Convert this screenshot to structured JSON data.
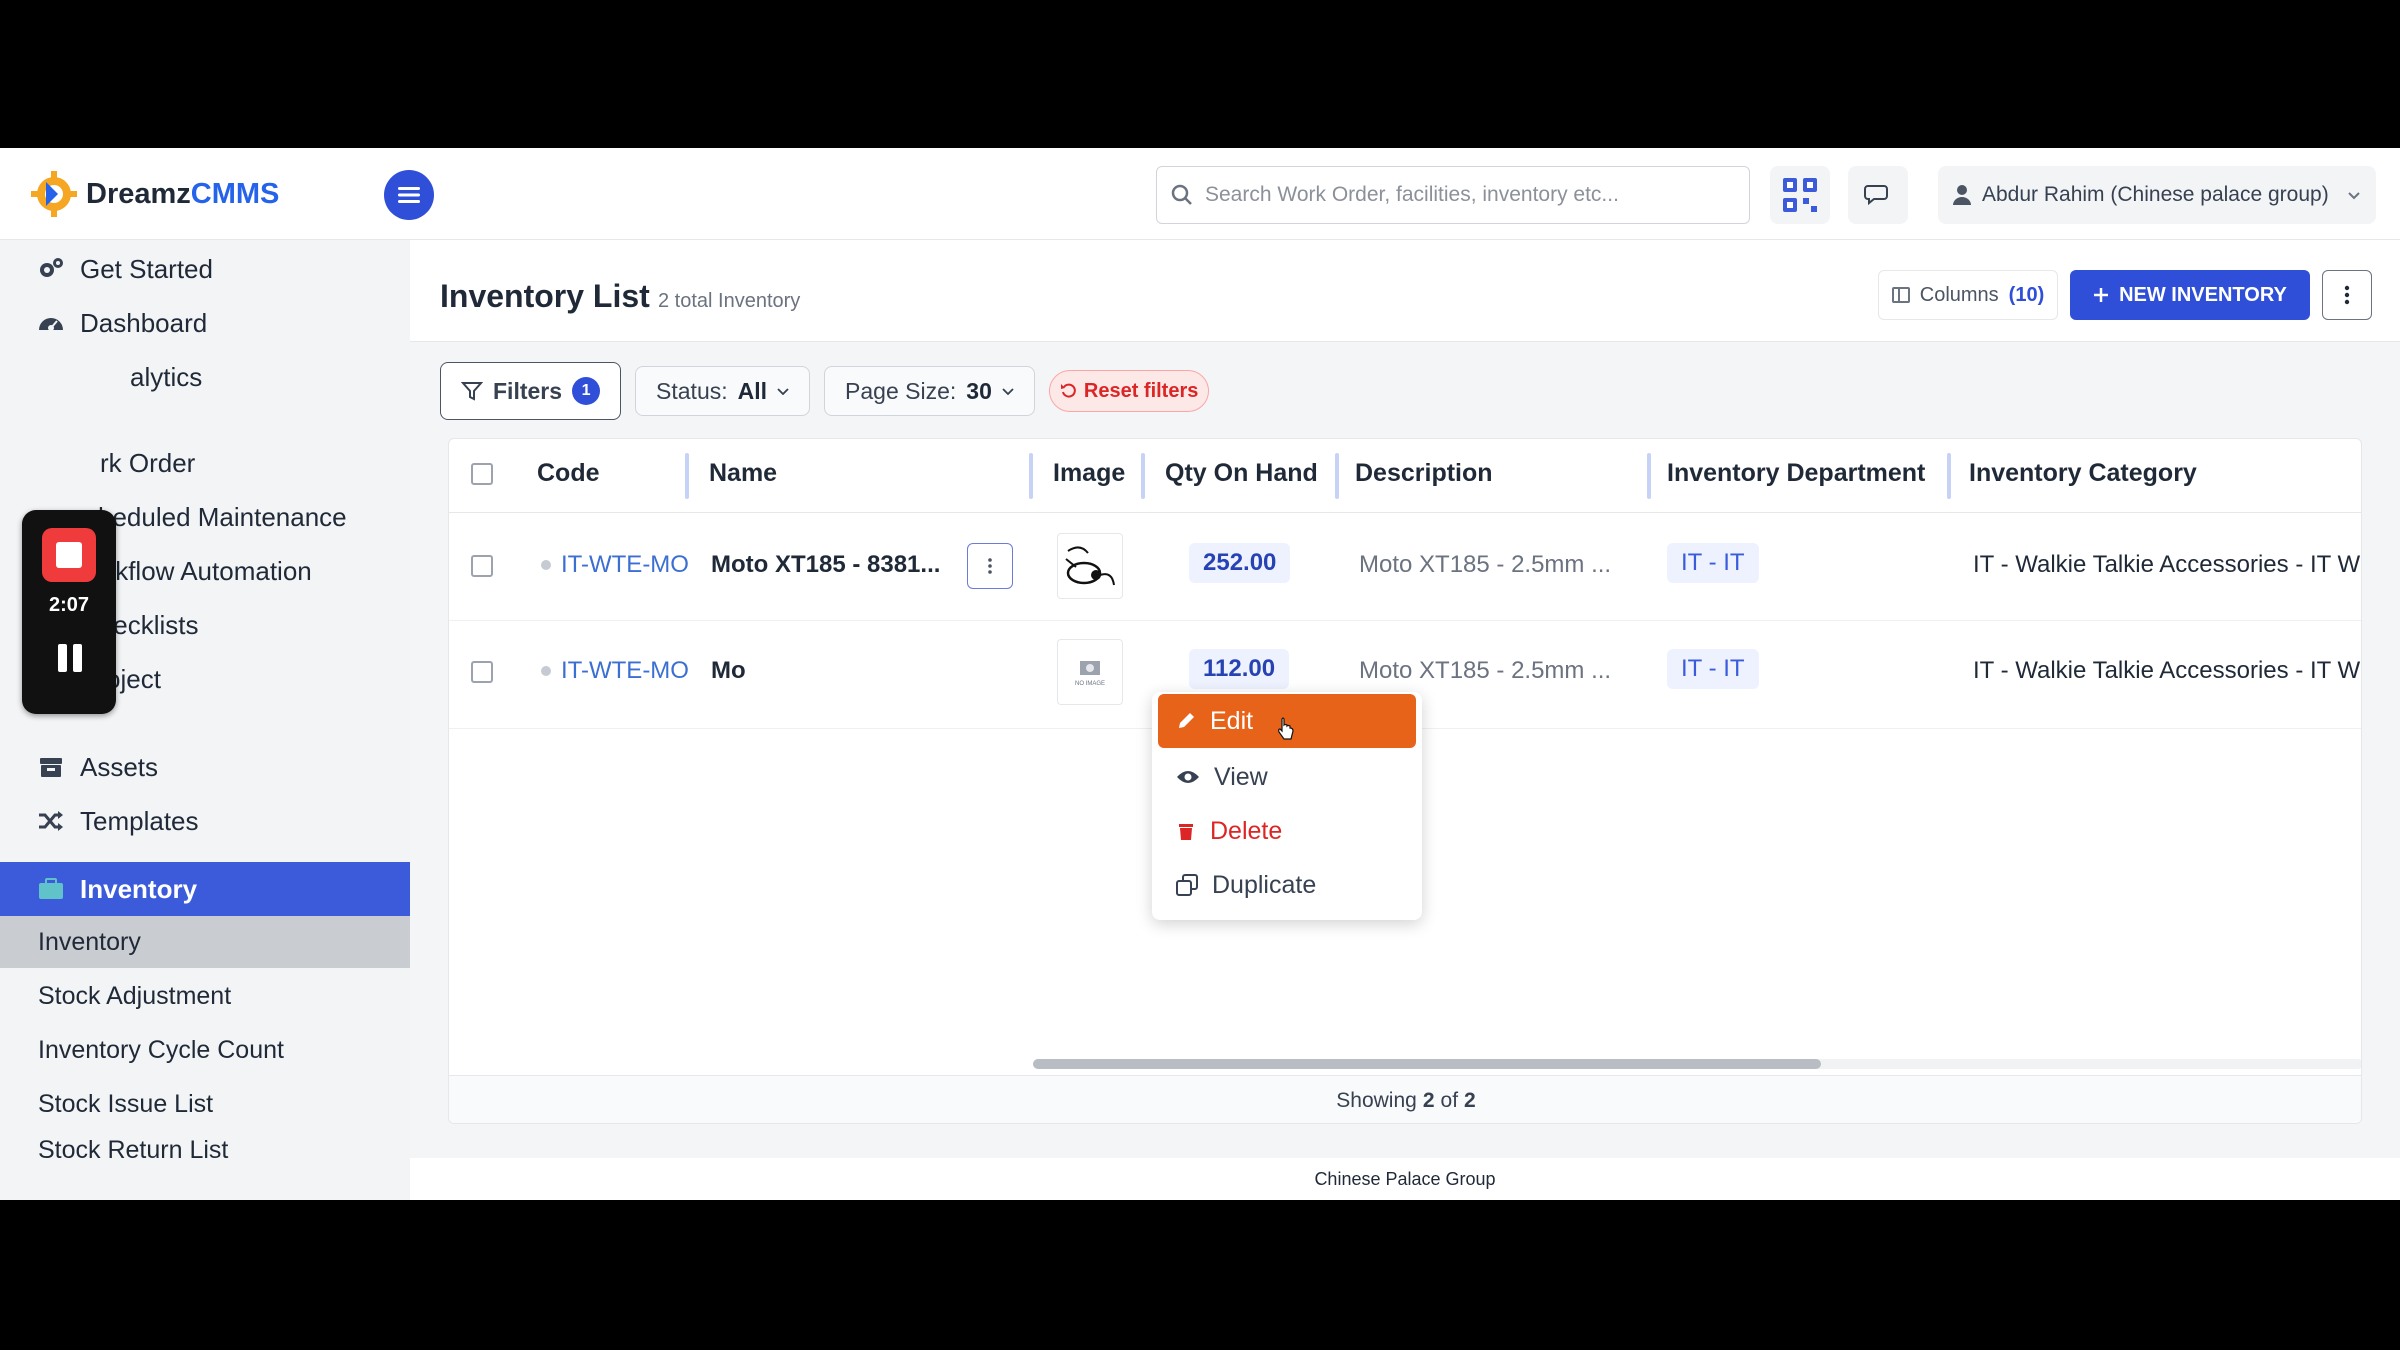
{
  "app": {
    "brand_prefix": "Dreamz",
    "brand_suffix": "CMMS",
    "search_placeholder": "Search Work Order, facilities, inventory etc...",
    "user_name": "Abdur Rahim (Chinese palace group)"
  },
  "sidebar": {
    "items": [
      {
        "label": "Get Started",
        "icon": "gears-icon"
      },
      {
        "label": "Dashboard",
        "icon": "dashboard-icon"
      },
      {
        "label": "alytics",
        "icon": "analytics-icon"
      },
      {
        "label": "rk Order",
        "icon": "work-order-icon"
      },
      {
        "label": "heduled Maintenance",
        "icon": "schedule-icon"
      },
      {
        "label": "Workflow Automation",
        "icon": "workflow-icon"
      },
      {
        "label": "Checklists",
        "icon": "checkbox-icon"
      },
      {
        "label": "Project",
        "icon": "project-icon"
      },
      {
        "label": "Assets",
        "icon": "assets-icon"
      },
      {
        "label": "Templates",
        "icon": "shuffle-icon"
      },
      {
        "label": "Inventory",
        "icon": "briefcase-icon"
      }
    ],
    "sub_items": [
      "Inventory",
      "Stock Adjustment",
      "Inventory Cycle Count",
      "Stock Issue List",
      "Stock Return List"
    ]
  },
  "recorder": {
    "time": "2:07"
  },
  "page": {
    "title": "Inventory List",
    "subtitle": "2 total Inventory",
    "columns_label": "Columns",
    "columns_count": "(10)",
    "new_label": "NEW INVENTORY"
  },
  "filters": {
    "filters_label": "Filters",
    "filters_count": "1",
    "status_label": "Status:",
    "status_value": "All",
    "page_size_label": "Page Size:",
    "page_size_value": "30",
    "reset_label": "Reset filters"
  },
  "table": {
    "headers": [
      "Code",
      "Name",
      "Image",
      "Qty On Hand",
      "Description",
      "Inventory Department",
      "Inventory Category"
    ],
    "rows": [
      {
        "code": "IT-WTE-MO",
        "name": "Moto XT185 - 8381...",
        "qty": "252.00",
        "description": "Moto XT185 - 2.5mm ...",
        "department": "IT - IT",
        "category": "IT - Walkie Talkie Accessories - IT W"
      },
      {
        "code": "IT-WTE-MO",
        "name": "Mo",
        "qty": "112.00",
        "description": "Moto XT185 - 2.5mm ...",
        "department": "IT - IT",
        "category": "IT - Walkie Talkie Accessories - IT W"
      }
    ],
    "no_image_text": "NO IMAGE",
    "footer_prefix": "Showing",
    "footer_shown": "2",
    "footer_of": "of",
    "footer_total": "2"
  },
  "dropdown": {
    "edit": "Edit",
    "view": "View",
    "delete": "Delete",
    "duplicate": "Duplicate"
  },
  "footer": {
    "text": "Chinese Palace Group"
  },
  "colors": {
    "primary": "#2f4fd8",
    "accent_orange": "#e8631a",
    "danger": "#dc2626"
  }
}
